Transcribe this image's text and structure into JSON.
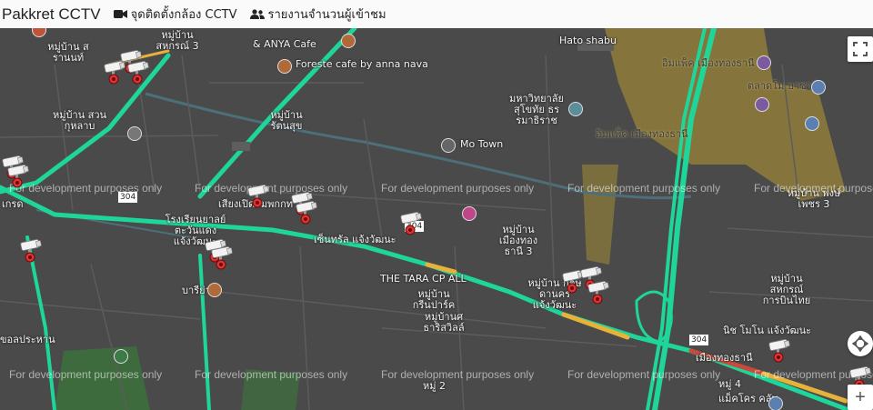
{
  "navbar": {
    "brand": "Pakkret CCTV",
    "links": [
      {
        "label": "จุดติดตั้งกล้อง CCTV",
        "icon": "video-camera-icon"
      },
      {
        "label": "รายงานจำนวนผู้เข้าชม",
        "icon": "users-icon"
      }
    ]
  },
  "map": {
    "watermark": "For development purposes only",
    "controls": {
      "fullscreen": "fullscreen-icon",
      "locate": "location-icon",
      "zoom_in": "+"
    },
    "road_shields": [
      "304",
      "304",
      "304"
    ],
    "places": [
      "หมู่บ้าน สรานนท์",
      "หมู่บ้าน สหกรณ์ 3",
      "Foreste cafe by anna nava",
      "& ANYA Cafe",
      "Hato shabu",
      "อิมแพ็ค เมืองทองธานี",
      "ตลาดโม บาซาร์",
      "หมู่บ้าน สวนกุหลาบ",
      "หมู่บ้าน รัตนสุข",
      "มหาวิทยาลัย สุโขทัย ธรรมาธิราช",
      "Mo Town",
      "อิมแพ็ค เมืองทองธานี",
      "เสียงเปิดลมพกกท",
      "โรงเรียนยาลย์ ตะวันแดง แจ้งวัฒนะ",
      "เซ็นทรัล แจ้งวัฒนะ",
      "หมู่บ้าน เมืองทอง ธานี 3",
      "THE TARA CP ALL",
      "หมู่บ้าน กรีนปาร์ค",
      "หมู่บ้านศ ธาริสวิลล์",
      "หมู่บ้าน กฤษดานคร แจ้งวัฒนะ",
      "หมู่บ้าน สหกรณ์ การบินไทย",
      "หมู่บ้าน พงษ์เพชร 3",
      "นิช โมโน แจ้งวัฒนะ",
      "เมืองทองธานี",
      "หมู่ 2",
      "หมู่ 4",
      "บารีย่าง",
      "ขอลประหาน",
      "แม็คโคร คลับ",
      "เกรด"
    ]
  }
}
